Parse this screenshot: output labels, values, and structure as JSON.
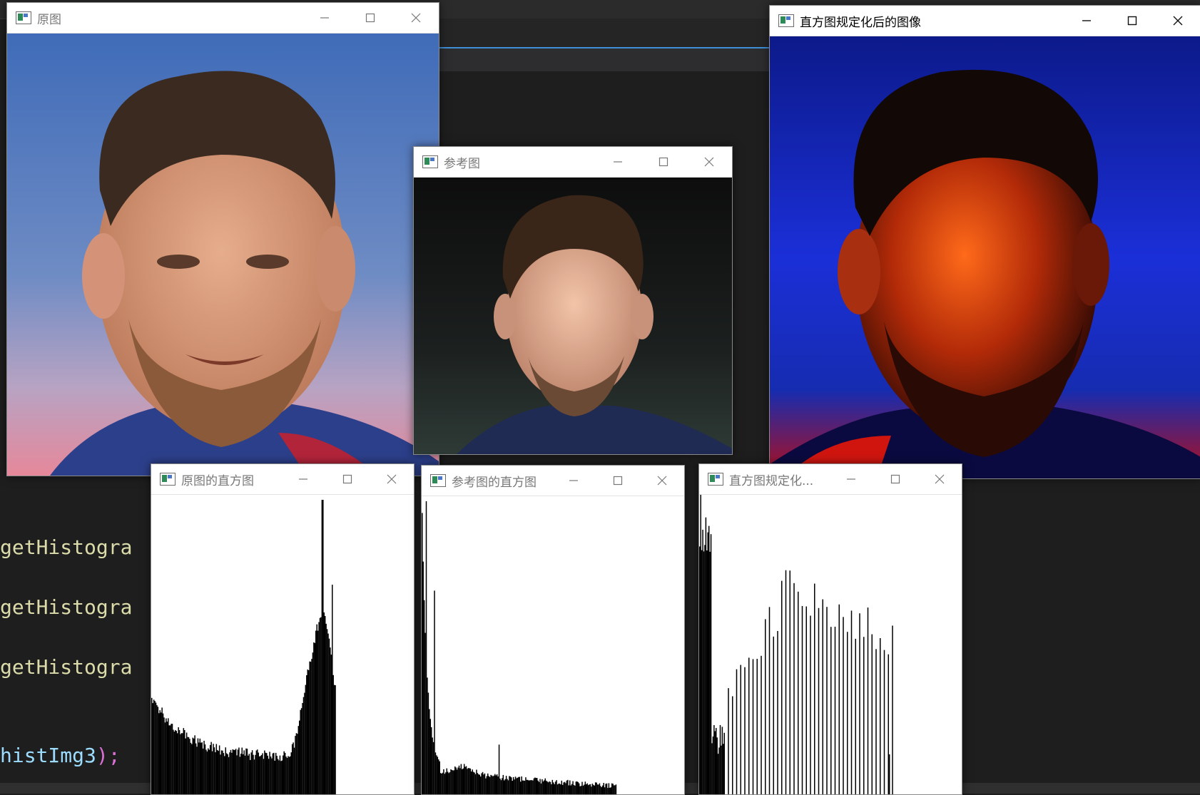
{
  "windows": {
    "original": {
      "title": "原图"
    },
    "reference": {
      "title": "参考图"
    },
    "result": {
      "title": "直方图规定化后的图像"
    },
    "hist_original": {
      "title": "原图的直方图"
    },
    "hist_reference": {
      "title": "参考图的直方图"
    },
    "hist_result": {
      "title": "直方图规定化..."
    }
  },
  "window_controls": {
    "minimize_icon": "minimize-icon",
    "maximize_icon": "maximize-icon",
    "close_icon": "close-icon"
  },
  "code": {
    "line1": "getHistogra",
    "line2": "getHistogra",
    "line3": "getHistogra",
    "line4_ident": "histImg3",
    "line4_tail": ");"
  },
  "colors": {
    "ide_bg": "#1e1e1e",
    "code_function": "#dcdcaa",
    "accent_tab": "#3f8fd6"
  }
}
